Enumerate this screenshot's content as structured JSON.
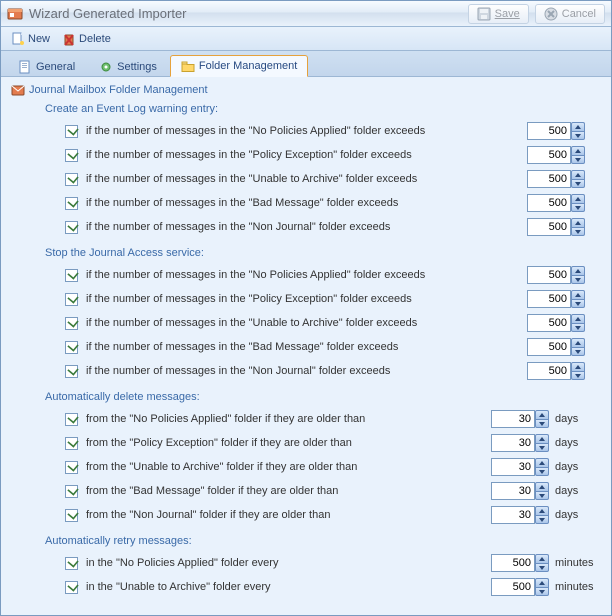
{
  "window": {
    "title": "Wizard Generated Importer",
    "save": "Save",
    "cancel": "Cancel"
  },
  "toolbar": {
    "new": "New",
    "delete": "Delete"
  },
  "tabs": {
    "general": "General",
    "settings": "Settings",
    "folder": "Folder Management"
  },
  "page": {
    "title": "Journal Mailbox Folder Management"
  },
  "sections": {
    "eventlog": {
      "title": "Create an Event Log warning entry:",
      "rows": [
        {
          "label": "if the number of messages in the \"No Policies Applied\" folder exceeds",
          "value": 500
        },
        {
          "label": "if the number of messages in the \"Policy Exception\" folder exceeds",
          "value": 500
        },
        {
          "label": "if the number of messages in the \"Unable to Archive\" folder exceeds",
          "value": 500
        },
        {
          "label": "if the number of messages in the \"Bad Message\" folder exceeds",
          "value": 500
        },
        {
          "label": "if the number of messages in the \"Non Journal\" folder exceeds",
          "value": 500
        }
      ]
    },
    "stopservice": {
      "title": "Stop the Journal Access service:",
      "rows": [
        {
          "label": "if the number of messages in the \"No Policies Applied\" folder exceeds",
          "value": 500
        },
        {
          "label": "if the number of messages in the \"Policy Exception\" folder exceeds",
          "value": 500
        },
        {
          "label": "if the number of messages in the \"Unable to Archive\" folder exceeds",
          "value": 500
        },
        {
          "label": "if the number of messages in the \"Bad Message\" folder exceeds",
          "value": 500
        },
        {
          "label": "if the number of messages in the \"Non Journal\" folder exceeds",
          "value": 500
        }
      ]
    },
    "autodelete": {
      "title": "Automatically delete messages:",
      "unit": "days",
      "rows": [
        {
          "label": "from the \"No Policies Applied\" folder if they are older than",
          "value": 30
        },
        {
          "label": "from the \"Policy Exception\" folder if they are older than",
          "value": 30
        },
        {
          "label": "from the \"Unable to Archive\" folder if they are older than",
          "value": 30
        },
        {
          "label": "from the \"Bad Message\" folder if they are older than",
          "value": 30
        },
        {
          "label": "from the \"Non Journal\" folder if they are older than",
          "value": 30
        }
      ]
    },
    "autoretry": {
      "title": "Automatically retry messages:",
      "unit": "minutes",
      "rows": [
        {
          "label": "in the \"No Policies Applied\" folder every",
          "value": 500
        },
        {
          "label": "in the \"Unable to Archive\" folder every",
          "value": 500
        }
      ]
    }
  }
}
